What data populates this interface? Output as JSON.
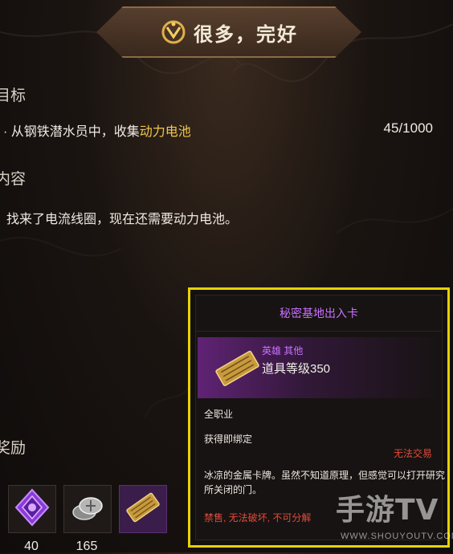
{
  "header": {
    "title": "很多，完好",
    "icon": "ornate-emblem-icon"
  },
  "sections": {
    "goal_label": "目标",
    "content_label": "内容",
    "reward_label": "奖励"
  },
  "objective": {
    "prefix": "· 从钢铁潜水员中，收集",
    "highlight": "动力电池",
    "progress": "45/1000"
  },
  "content": {
    "text": "找来了电流线圈，现在还需要动力电池。"
  },
  "rewards": [
    {
      "icon": "purple-crystal-icon",
      "count": "40"
    },
    {
      "icon": "silver-coins-icon",
      "count": "165"
    },
    {
      "icon": "gold-access-card-icon",
      "count": ""
    }
  ],
  "tooltip": {
    "title": "秘密基地出入卡",
    "type": "英雄 其他",
    "level": "道具等级350",
    "class": "全职业",
    "bind": "获得即绑定",
    "trade": "无法交易",
    "description": "冰凉的金属卡牌。虽然不知道原理，但感觉可以打开研究所关闭的门。",
    "restrictions": "禁售, 无法破坏, 不可分解",
    "border_color": "#e6d300",
    "title_color": "#c971ff"
  },
  "watermark": {
    "main": "手游TV",
    "sub": "WWW.SHOUYOUTV.COM"
  }
}
